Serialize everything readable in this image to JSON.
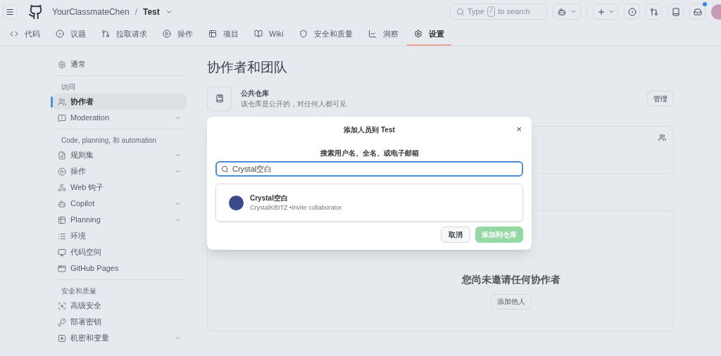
{
  "header": {
    "owner": "YourClassmateChen",
    "separator": "/",
    "repo": "Test",
    "search": {
      "before": "Type",
      "key": "/",
      "after": "to search"
    },
    "notification_unread": true
  },
  "nav": [
    {
      "label": "代码",
      "selected": false
    },
    {
      "label": "议题",
      "selected": false
    },
    {
      "label": "拉取请求",
      "selected": false
    },
    {
      "label": "操作",
      "selected": false
    },
    {
      "label": "项目",
      "selected": false
    },
    {
      "label": "Wiki",
      "selected": false
    },
    {
      "label": "安全和质量",
      "selected": false
    },
    {
      "label": "洞察",
      "selected": false
    },
    {
      "label": "设置",
      "selected": true
    }
  ],
  "sidebar": [
    {
      "items": [
        {
          "label": "通常",
          "selected": false,
          "expandable": false
        }
      ]
    },
    {
      "heading": "访问",
      "items": [
        {
          "label": "协作者",
          "selected": true,
          "expandable": false
        },
        {
          "label": "Moderation",
          "selected": false,
          "expandable": true
        }
      ]
    },
    {
      "heading": "Code, planning, 和 automation",
      "items": [
        {
          "label": "规则集",
          "selected": false,
          "expandable": true
        },
        {
          "label": "操作",
          "selected": false,
          "expandable": true
        },
        {
          "label": "Web 钩子",
          "selected": false,
          "expandable": false
        },
        {
          "label": "Copilot",
          "selected": false,
          "expandable": true
        },
        {
          "label": "Planning",
          "selected": false,
          "expandable": true
        },
        {
          "label": "环境",
          "selected": false,
          "expandable": false
        },
        {
          "label": "代码空间",
          "selected": false,
          "expandable": false
        },
        {
          "label": "GitHub Pages",
          "selected": false,
          "expandable": false
        }
      ]
    },
    {
      "heading": "安全和质量",
      "items": [
        {
          "label": "高级安全",
          "selected": false,
          "expandable": false
        },
        {
          "label": "部署密钥",
          "selected": false,
          "expandable": false
        },
        {
          "label": "机密和变量",
          "selected": false,
          "expandable": true
        }
      ]
    }
  ],
  "main": {
    "title": "协作者和团队",
    "visibility": {
      "title": "公共仓库",
      "description": "该仓库是公开的，对任何人都可见"
    },
    "manage_button": "管理",
    "empty_title": "您尚未邀请任何协作者",
    "add_button": "添加他人"
  },
  "dialog": {
    "title": "添加人员到 Test",
    "close": "×",
    "label": "搜索用户名、全名、或电子邮箱",
    "value": "Crystal空白",
    "results": [
      {
        "name": "Crystal空白",
        "detail": "CrystalKBITZ •Invite collaborator"
      }
    ],
    "cancel": "取消",
    "submit": {
      "label": "添加到仓库",
      "disabled": true
    }
  }
}
